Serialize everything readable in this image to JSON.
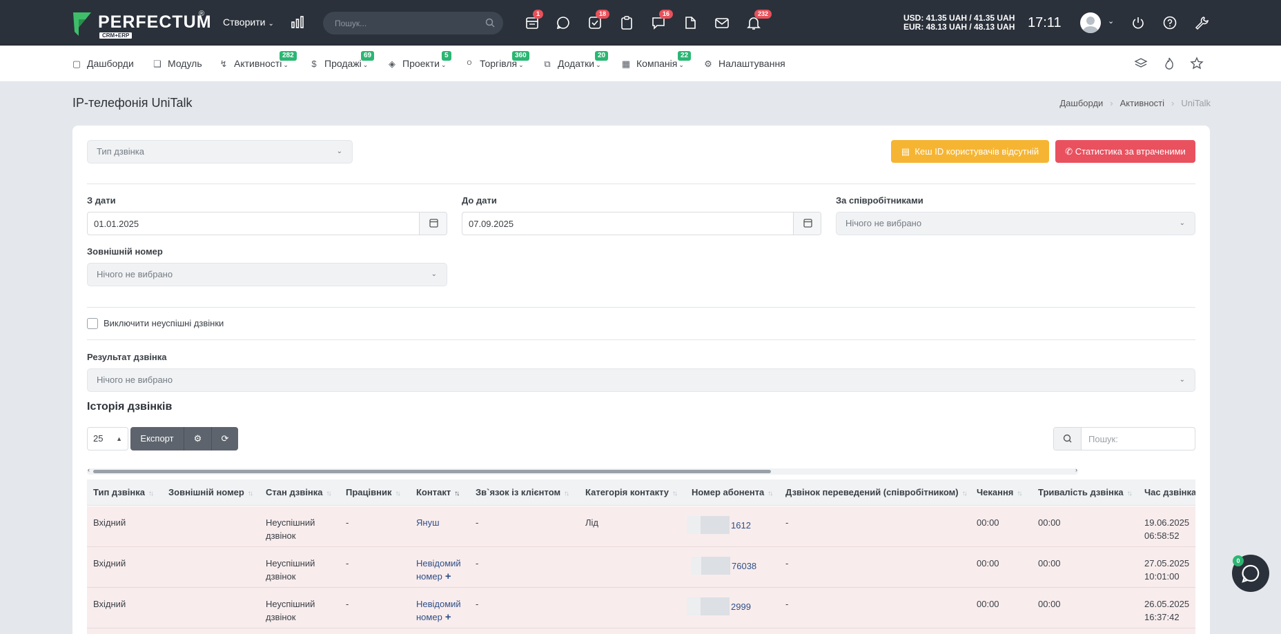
{
  "topbar": {
    "logo_text": "PERFECTUM",
    "logo_reg": "®",
    "logo_sub": "CRM+ERP",
    "create_label": "Створити",
    "search_placeholder": "Пошук...",
    "icons": [
      {
        "name": "calendar-list-icon",
        "badge": "1"
      },
      {
        "name": "chat-icon",
        "badge": ""
      },
      {
        "name": "tasks-icon",
        "badge": "18"
      },
      {
        "name": "clipboard-icon",
        "badge": ""
      },
      {
        "name": "comments-icon",
        "badge": "16"
      },
      {
        "name": "document-icon",
        "badge": ""
      },
      {
        "name": "mail-icon",
        "badge": ""
      },
      {
        "name": "bell-icon",
        "badge": "232"
      }
    ],
    "currency_usd": "USD: 41.35 UAH / 41.35 UAH",
    "currency_eur": "EUR: 48.13 UAH / 48.13 UAH",
    "time": "17:11"
  },
  "nav": {
    "items": [
      {
        "label": "Дашборди",
        "icon": "monitor-icon",
        "badge": ""
      },
      {
        "label": "Модуль",
        "icon": "cube-icon",
        "badge": ""
      },
      {
        "label": "Активності",
        "icon": "bolt-icon",
        "badge": "282"
      },
      {
        "label": "Продажі",
        "icon": "dollar-icon",
        "badge": "69"
      },
      {
        "label": "Проекти",
        "icon": "layers-icon",
        "badge": "5"
      },
      {
        "label": "Торгівля",
        "icon": "cart-icon",
        "badge": "360"
      },
      {
        "label": "Додатки",
        "icon": "copy-icon",
        "badge": "20"
      },
      {
        "label": "Компанія",
        "icon": "building-icon",
        "badge": "22"
      },
      {
        "label": "Налаштування",
        "icon": "gear-icon",
        "badge": ""
      }
    ]
  },
  "page": {
    "title": "IP-телефонія UniTalk",
    "breadcrumb": [
      "Дашборди",
      "Активності",
      "UniTalk"
    ]
  },
  "filters": {
    "call_type_placeholder": "Тип дзвінка",
    "btn_cache": "Кеш ID користувачів відсутній",
    "btn_stats": "Статистика за втраченими",
    "date_from_label": "З дати",
    "date_from_value": "01.01.2025",
    "date_to_label": "До дати",
    "date_to_value": "07.09.2025",
    "employees_label": "За співробітниками",
    "employees_value": "Нічого не вибрано",
    "external_label": "Зовнішній номер",
    "external_value": "Нічого не вибрано",
    "exclude_label": "Виключити неуспішні дзвінки",
    "result_label": "Результат дзвінка",
    "result_value": "Нічого не вибрано"
  },
  "history": {
    "title": "Історія дзвінків",
    "page_length": "25",
    "export_label": "Експорт",
    "search_placeholder": "Пошук:"
  },
  "table": {
    "columns": [
      "Тип дзвінка",
      "Зовнішній номер",
      "Стан дзвінка",
      "Працівник",
      "Контакт",
      "Зв`язок із клієнтом",
      "Категорія контакту",
      "Номер абонента",
      "Дзвінок переведений (співробітником)",
      "Чекання",
      "Тривалість дзвінка",
      "Час дзвінка"
    ],
    "rows": [
      {
        "type": "Вхідний",
        "external": "",
        "state1": "Неуспішний",
        "state2": "дзвінок",
        "employee": "-",
        "contact1": "Януш",
        "contact2": "",
        "contact_plus": false,
        "relation": "-",
        "category": "Лід",
        "number": "1612",
        "transferred": "-",
        "wait": "00:00",
        "duration": "00:00",
        "date": "19.06.2025",
        "time": "06:58:52"
      },
      {
        "type": "Вхідний",
        "external": "",
        "state1": "Неуспішний",
        "state2": "дзвінок",
        "employee": "-",
        "contact1": "Невідомий",
        "contact2": "номер",
        "contact_plus": true,
        "relation": "-",
        "category": "",
        "number": "76038",
        "transferred": "-",
        "wait": "00:00",
        "duration": "00:00",
        "date": "27.05.2025",
        "time": "10:01:00"
      },
      {
        "type": "Вхідний",
        "external": "",
        "state1": "Неуспішний",
        "state2": "дзвінок",
        "employee": "-",
        "contact1": "Невідомий",
        "contact2": "номер",
        "contact_plus": true,
        "relation": "-",
        "category": "",
        "number": "2999",
        "transferred": "-",
        "wait": "00:00",
        "duration": "00:00",
        "date": "26.05.2025",
        "time": "16:37:42"
      }
    ]
  },
  "chat": {
    "badge": "0"
  },
  "colors": {
    "topbar": "#2a313b",
    "warning": "#f5b533",
    "danger": "#e9515f",
    "badge_green": "#2bb673",
    "badge_red": "#e8515a",
    "row_bg": "#f8eced"
  }
}
